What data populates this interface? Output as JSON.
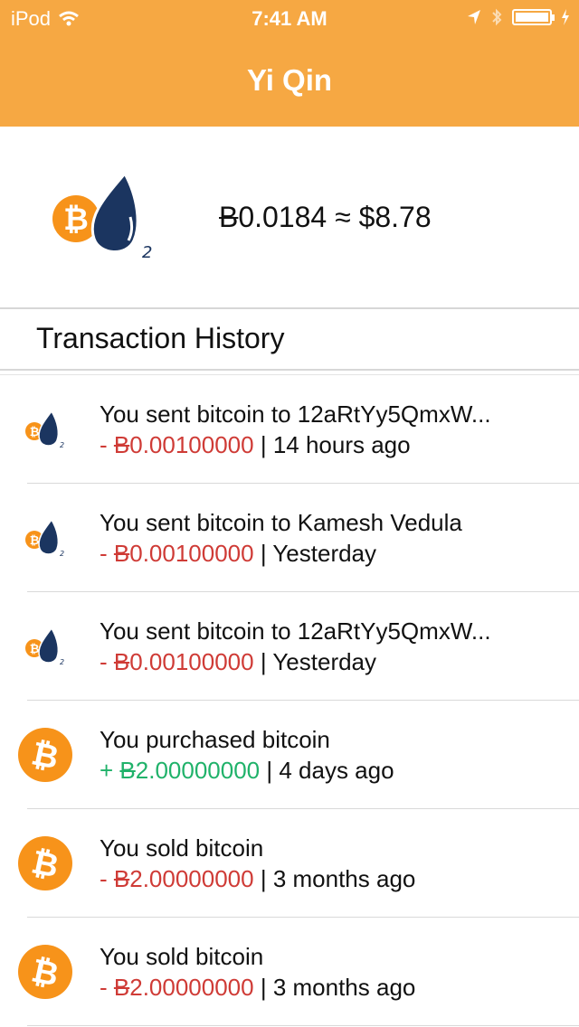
{
  "status_bar": {
    "carrier": "iPod",
    "time": "7:41 AM"
  },
  "header": {
    "title": "Yi Qin"
  },
  "balance": {
    "btc_symbol": "B",
    "btc_amount": "0.0184",
    "approx": "≈",
    "usd": "$8.78"
  },
  "history": {
    "title": "Transaction History",
    "rows": [
      {
        "icon": "coin-drop-icon",
        "desc": "You sent bitcoin to 12aRtYy5QmxW...",
        "sign": "- ",
        "btc_symbol": "B",
        "amount": "0.00100000",
        "separator": " | ",
        "when": "14 hours ago",
        "color": "#cf3b36"
      },
      {
        "icon": "coin-drop-icon",
        "desc": "You sent bitcoin to Kamesh Vedula",
        "sign": "- ",
        "btc_symbol": "B",
        "amount": "0.00100000",
        "separator": " | ",
        "when": "Yesterday",
        "color": "#cf3b36"
      },
      {
        "icon": "coin-drop-icon",
        "desc": "You sent bitcoin to 12aRtYy5QmxW...",
        "sign": "- ",
        "btc_symbol": "B",
        "amount": "0.00100000",
        "separator": " | ",
        "when": "Yesterday",
        "color": "#cf3b36"
      },
      {
        "icon": "bitcoin-icon",
        "desc": "You purchased bitcoin",
        "sign": "+ ",
        "btc_symbol": "B",
        "amount": "2.00000000",
        "separator": " | ",
        "when": "4 days ago",
        "color": "#20b26a"
      },
      {
        "icon": "bitcoin-icon",
        "desc": "You sold bitcoin",
        "sign": "- ",
        "btc_symbol": "B",
        "amount": "2.00000000",
        "separator": " | ",
        "when": "3 months ago",
        "color": "#cf3b36"
      },
      {
        "icon": "bitcoin-icon",
        "desc": "You sold bitcoin",
        "sign": "- ",
        "btc_symbol": "B",
        "amount": "2.00000000",
        "separator": " | ",
        "when": "3 months ago",
        "color": "#cf3b36"
      }
    ]
  },
  "colors": {
    "header_bg": "#f6a843",
    "coin": "#f7931a",
    "drop": "#1b3560"
  }
}
